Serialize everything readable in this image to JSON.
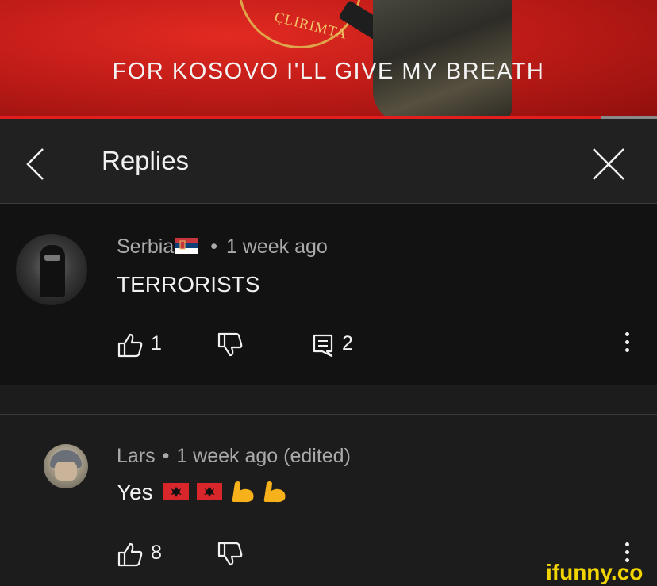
{
  "banner": {
    "seal_text": "ÇLIRIMTA",
    "caption": "FOR KOSOVO I'LL GIVE MY BREATH"
  },
  "header": {
    "title": "Replies"
  },
  "comments": [
    {
      "author": "Serbia",
      "author_flag": "serbia-flag-icon",
      "separator": "•",
      "time": "1 week ago",
      "text": "TERRORISTS",
      "likes": "1",
      "replies": "2"
    },
    {
      "author": "Lars",
      "separator": "•",
      "time": "1 week ago (edited)",
      "text": "Yes",
      "emojis": [
        "albania-flag-icon",
        "albania-flag-icon",
        "flexed-biceps-icon",
        "flexed-biceps-icon"
      ],
      "likes": "8"
    }
  ],
  "watermark": "ifunny.co",
  "colors": {
    "accent": "#e21e1e",
    "background": "#1c1c1c",
    "comment_highlight": "#121212",
    "meta_text": "#aaaaaa",
    "watermark": "#f2d400"
  }
}
